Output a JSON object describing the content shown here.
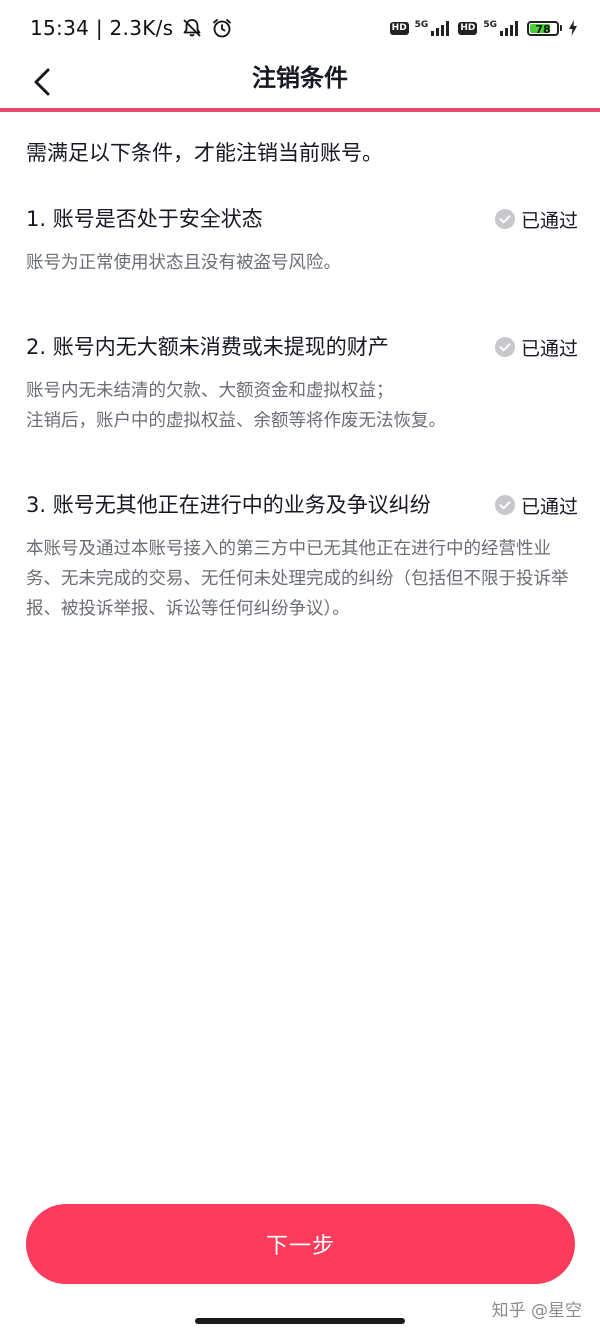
{
  "status_bar": {
    "time": "15:34",
    "net_speed": "2.3K/s",
    "sim1_badge": "HD",
    "sim1_net": "5G",
    "sim2_badge": "HD",
    "sim2_net": "5G",
    "battery_level": "78",
    "icons": [
      "mute-bell-icon",
      "alarm-icon",
      "signal-icon",
      "battery-icon",
      "charging-icon"
    ]
  },
  "header": {
    "title": "注销条件",
    "back_icon": "chevron-left-icon",
    "accent_color": "#ea4a6e"
  },
  "intro": "需满足以下条件，才能注销当前账号。",
  "conditions": [
    {
      "title": "1. 账号是否处于安全状态",
      "status": "已通过",
      "description": "账号为正常使用状态且没有被盗号风险。"
    },
    {
      "title": "2. 账号内无大额未消费或未提现的财产",
      "status": "已通过",
      "description_lines": [
        "账号内无未结清的欠款、大额资金和虚拟权益；",
        "注销后，账户中的虚拟权益、余额等将作废无法恢复。"
      ]
    },
    {
      "title": "3. 账号无其他正在进行中的业务及争议纠纷",
      "status": "已通过",
      "description": "本账号及通过本账号接入的第三方中已无其他正在进行中的经营性业务、无未完成的交易、无任何未处理完成的纠纷（包括但不限于投诉举报、被投诉举报、诉讼等任何纠纷争议）。"
    }
  ],
  "next_button": {
    "label": "下一步",
    "color": "#fd3b5c"
  },
  "watermark": "知乎 @星空"
}
